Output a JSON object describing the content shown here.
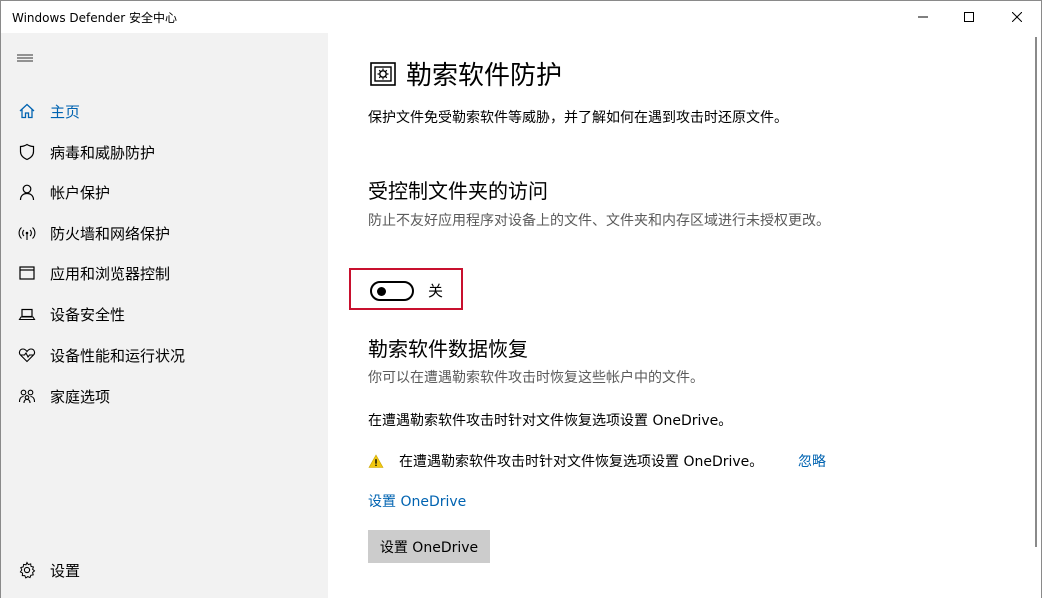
{
  "window": {
    "title": "Windows Defender 安全中心"
  },
  "sidebar": {
    "items": [
      {
        "label": "主页",
        "icon": "home-icon"
      },
      {
        "label": "病毒和威胁防护",
        "icon": "shield-icon"
      },
      {
        "label": "帐户保护",
        "icon": "person-icon"
      },
      {
        "label": "防火墙和网络保护",
        "icon": "wireless-icon"
      },
      {
        "label": "应用和浏览器控制",
        "icon": "browser-window-icon"
      },
      {
        "label": "设备安全性",
        "icon": "laptop-icon"
      },
      {
        "label": "设备性能和运行状况",
        "icon": "heart-pulse-icon"
      },
      {
        "label": "家庭选项",
        "icon": "family-icon"
      }
    ],
    "settings_label": "设置",
    "active_index": 0
  },
  "main": {
    "title": "勒索软件防护",
    "description": "保护文件免受勒索软件等威胁，并了解如何在遇到攻击时还原文件。",
    "cfa": {
      "title": "受控制文件夹的访问",
      "description": "防止不友好应用程序对设备上的文件、文件夹和内存区域进行未授权更改。",
      "toggle_state": "关"
    },
    "recovery": {
      "title": "勒索软件数据恢复",
      "description": "你可以在遭遇勒索软件攻击时恢复这些帐户中的文件。",
      "info": "在遭遇勒索软件攻击时针对文件恢复选项设置 OneDrive。",
      "warning": "在遭遇勒索软件攻击时针对文件恢复选项设置 OneDrive。",
      "dismiss_label": "忽略",
      "link_label": "设置 OneDrive",
      "button_label": "设置 OneDrive"
    }
  },
  "colors": {
    "accent": "#0063b1",
    "highlight_border": "#c8102e",
    "warning": "#f2c811",
    "sidebar_bg": "#f2f2f2",
    "button_bg": "#cccccc"
  }
}
